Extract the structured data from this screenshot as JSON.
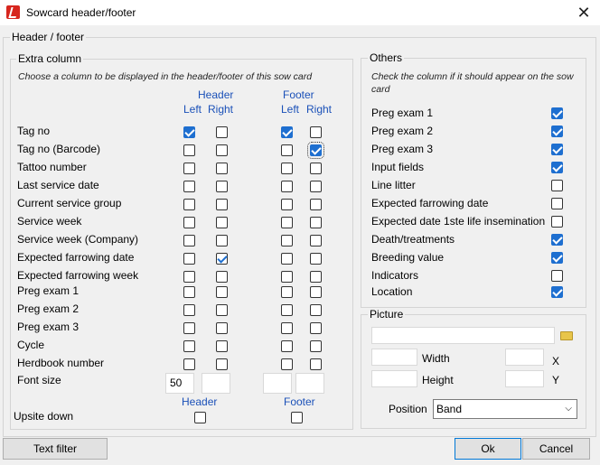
{
  "window": {
    "title": "Sowcard header/footer"
  },
  "header_footer_group": {
    "label": "Header / footer"
  },
  "extra_column": {
    "label": "Extra column",
    "hint": "Choose a column to be displayed in the header/footer of this sow card",
    "header_label": "Header",
    "footer_label": "Footer",
    "left_label": "Left",
    "right_label": "Right",
    "rows": [
      {
        "label": "Tag no",
        "h_left": true,
        "h_right": false,
        "f_left": true,
        "f_right": false
      },
      {
        "label": "Tag no (Barcode)",
        "h_left": false,
        "h_right": false,
        "f_left": false,
        "f_right": true
      },
      {
        "label": "Tattoo number",
        "h_left": false,
        "h_right": false,
        "f_left": false,
        "f_right": false
      },
      {
        "label": "Last service date",
        "h_left": false,
        "h_right": false,
        "f_left": false,
        "f_right": false
      },
      {
        "label": "Current service group",
        "h_left": false,
        "h_right": false,
        "f_left": false,
        "f_right": false
      },
      {
        "label": "Service week",
        "h_left": false,
        "h_right": false,
        "f_left": false,
        "f_right": false
      },
      {
        "label": "Service week (Company)",
        "h_left": false,
        "h_right": false,
        "f_left": false,
        "f_right": false
      },
      {
        "label": "Expected farrowing date",
        "h_left": false,
        "h_right": true,
        "f_left": false,
        "f_right": false
      },
      {
        "label": "Expected farrowing week",
        "h_left": false,
        "h_right": false,
        "f_left": false,
        "f_right": false
      },
      {
        "label": "Preg exam 1",
        "h_left": false,
        "h_right": false,
        "f_left": false,
        "f_right": false
      },
      {
        "label": "Preg exam 2",
        "h_left": false,
        "h_right": false,
        "f_left": false,
        "f_right": false
      },
      {
        "label": "Preg exam 3",
        "h_left": false,
        "h_right": false,
        "f_left": false,
        "f_right": false
      },
      {
        "label": "Cycle",
        "h_left": false,
        "h_right": false,
        "f_left": false,
        "f_right": false
      },
      {
        "label": "Herdbook number",
        "h_left": false,
        "h_right": false,
        "f_left": false,
        "f_right": false
      }
    ],
    "font_size_label": "Font size",
    "font_size_header_left": "50",
    "font_size_header_right": "",
    "font_size_footer_left": "",
    "font_size_footer_right": "",
    "header_caption": "Header",
    "footer_caption": "Footer",
    "upside_down_label": "Upsite down",
    "upside_down_header": false,
    "upside_down_footer": false
  },
  "others": {
    "label": "Others",
    "hint": "Check the column if it should appear on the sow card",
    "rows": [
      {
        "label": "Preg exam 1",
        "checked": true
      },
      {
        "label": "Preg exam 2",
        "checked": true
      },
      {
        "label": "Preg exam 3",
        "checked": true
      },
      {
        "label": "Input fields",
        "checked": true
      },
      {
        "label": "Line litter",
        "checked": false
      },
      {
        "label": "Expected farrowing date",
        "checked": false
      },
      {
        "label": "Expected date 1ste life insemination",
        "checked": false
      },
      {
        "label": "Death/treatments",
        "checked": true
      },
      {
        "label": "Breeding value",
        "checked": true
      },
      {
        "label": "Indicators",
        "checked": false
      },
      {
        "label": "Location",
        "checked": true
      }
    ]
  },
  "picture": {
    "label": "Picture",
    "path_value": "",
    "width_label": "Width",
    "height_label": "Height",
    "x_label": "X",
    "y_label": "Y",
    "width_value": "",
    "height_value": "",
    "x_value": "",
    "y_value": "",
    "position_label": "Position",
    "position_value": "Band"
  },
  "buttons": {
    "text_filter": "Text filter",
    "ok": "Ok",
    "cancel": "Cancel"
  },
  "colors": {
    "accent": "#1e6fd0",
    "label_blue": "#1a50b8",
    "icon_red": "#d7261e"
  }
}
